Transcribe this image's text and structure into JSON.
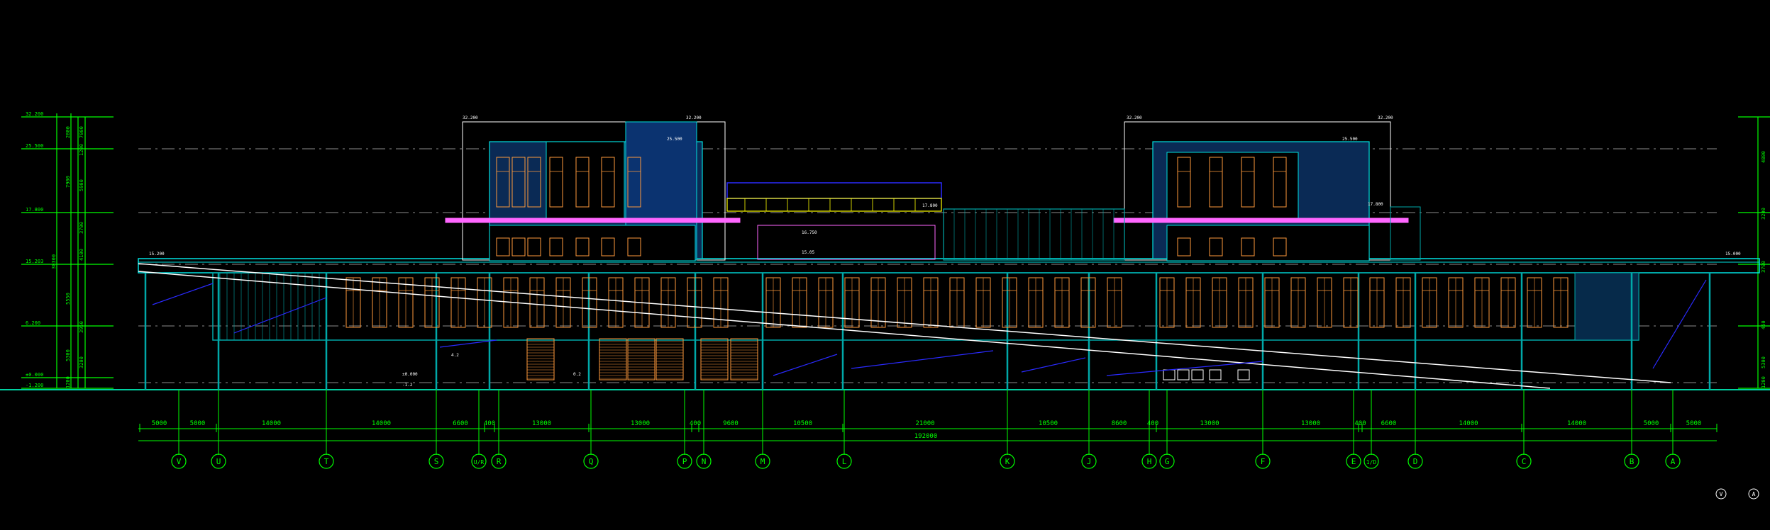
{
  "view": {
    "background": "#000000",
    "colors": {
      "green": "#00ff00",
      "cyan": "#00e0e0",
      "teal": "#00a8a8",
      "orange": "#ff9a3c",
      "magenta": "#ff66ff",
      "yellow": "#ffff00",
      "blue": "#2a2aff",
      "white": "#ffffff",
      "grey": "#8c8c8c"
    }
  },
  "dimensions": {
    "segments": [
      "5000",
      "5000",
      "14000",
      "14000",
      "6600",
      "400",
      "13000",
      "13000",
      "400",
      "9600",
      "10500",
      "21000",
      "10500",
      "8600",
      "400",
      "13000",
      "13000",
      "400",
      "6600",
      "14000",
      "14000",
      "5000",
      "5000"
    ],
    "total": "192000"
  },
  "grid_axes": [
    "V",
    "U",
    "T",
    "S",
    "U/R",
    "R",
    "Q",
    "P",
    "N",
    "M",
    "L",
    "K",
    "J",
    "H",
    "G",
    "F",
    "E",
    "1/D",
    "D",
    "C",
    "B",
    "A"
  ],
  "left_levels": {
    "elevations": [
      "32.200",
      "25.500",
      "17.800",
      "15.203",
      "6.200",
      "±0.000",
      "-1.200"
    ],
    "dims_inner": [
      "2800",
      "7900",
      "5550",
      "5300",
      "1200"
    ],
    "dims_outer": [
      "7000",
      "1200",
      "5900",
      "3700",
      "4100",
      "3950",
      "3200"
    ],
    "total": "30300"
  },
  "right_levels": {
    "dims": [
      "4800",
      "3200",
      "3700",
      "450",
      "5300",
      "1200"
    ]
  },
  "building_labels": {
    "roof_left": [
      "32.200",
      "32.200"
    ],
    "roof_right": [
      "32.200",
      "32.200"
    ],
    "mid_left": [
      "25.500",
      "17.800"
    ],
    "mid_right": [
      "25.500",
      "17.800"
    ],
    "canopy": [
      "16.750",
      "15.05"
    ],
    "ground": [
      "±0.000",
      "-1.2",
      "4.2",
      "0.2"
    ],
    "ramp_left": "15.200",
    "ramp_right": "15.000"
  },
  "compass": [
    "V",
    "A"
  ]
}
